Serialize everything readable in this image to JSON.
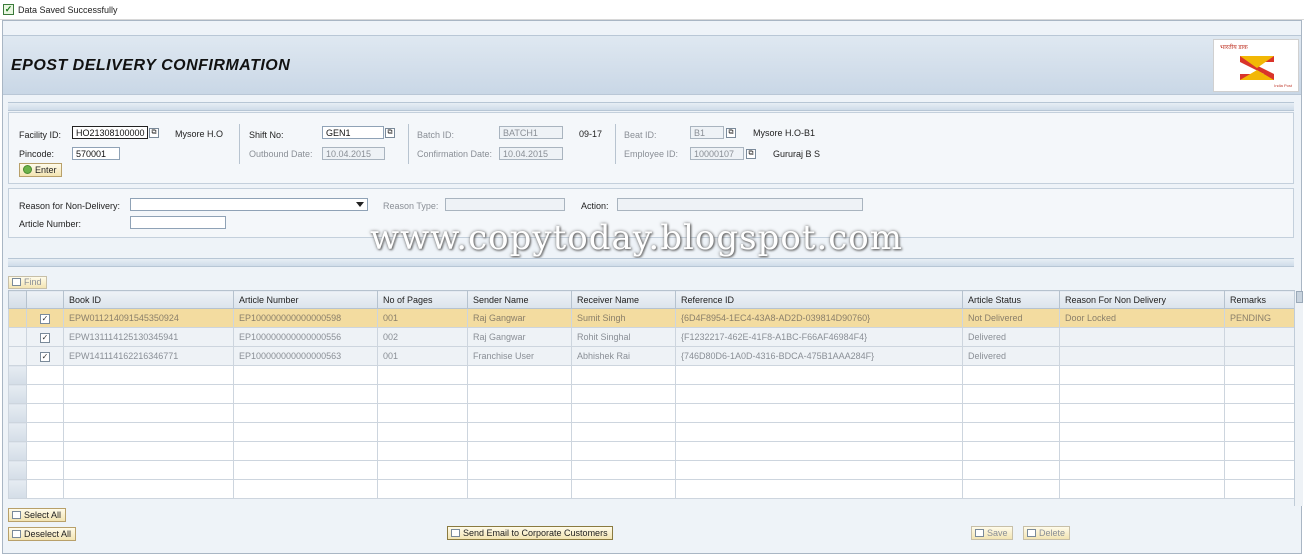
{
  "status": {
    "message": "Data Saved Successfully"
  },
  "header": {
    "title": "EPOST DELIVERY CONFIRMATION",
    "logo_text": "भारतीय डाक",
    "logo_subtext": "India Post"
  },
  "form": {
    "facility_id_label": "Facility ID:",
    "facility_id_value": "HO21308100000",
    "facility_name": "Mysore H.O",
    "pincode_label": "Pincode:",
    "pincode_value": "570001",
    "shift_no_label": "Shift No:",
    "shift_no_value": "GEN1",
    "outbound_date_label": "Outbound Date:",
    "outbound_date_value": "10.04.2015",
    "batch_id_label": "Batch ID:",
    "batch_id_value": "BATCH1",
    "batch_time": "09-17",
    "confirmation_date_label": "Confirmation Date:",
    "confirmation_date_value": "10.04.2015",
    "beat_id_label": "Beat ID:",
    "beat_id_value": "B1",
    "beat_name": "Mysore H.O-B1",
    "employee_id_label": "Employee ID:",
    "employee_id_value": "10000107",
    "employee_name": "Gururaj B S",
    "enter_button": "Enter"
  },
  "reason": {
    "reason_label": "Reason for Non-Delivery:",
    "reason_value": "",
    "reason_type_label": "Reason Type:",
    "reason_type_value": "",
    "action_label": "Action:",
    "action_value": "",
    "article_number_label": "Article Number:",
    "article_number_value": ""
  },
  "watermark": "www.copytoday.blogspot.com",
  "toolbar": {
    "find_button": "Find"
  },
  "table": {
    "columns": [
      "Book ID",
      "Article Number",
      "No of Pages",
      "Sender Name",
      "Receiver Name",
      "Reference ID",
      "Article Status",
      "Reason For Non Delivery",
      "Remarks"
    ],
    "rows": [
      {
        "checked": true,
        "selected": true,
        "cells": [
          "EPW011214091545350924",
          "EP100000000000000598",
          "001",
          "Raj Gangwar",
          "Sumit Singh",
          "{6D4F8954-1EC4-43A8-AD2D-039814D90760}",
          "Not Delivered",
          "Door Locked",
          "PENDING"
        ]
      },
      {
        "checked": true,
        "selected": false,
        "cells": [
          "EPW131114125130345941",
          "EP100000000000000556",
          "002",
          "Raj Gangwar",
          "Rohit Singhal",
          "{F1232217-462E-41F8-A1BC-F66AF46984F4}",
          "Delivered",
          "",
          ""
        ]
      },
      {
        "checked": true,
        "selected": false,
        "cells": [
          "EPW141114162216346771",
          "EP100000000000000563",
          "001",
          "Franchise User",
          "Abhishek Rai",
          "{746D80D6-1A0D-4316-BDCA-475B1AAA284F}",
          "Delivered",
          "",
          ""
        ]
      }
    ],
    "empty_rows": 7
  },
  "footer": {
    "select_all": "Select All",
    "deselect_all": "Deselect All",
    "send_email": "Send Email to Corporate Customers",
    "save": "Save",
    "delete": "Delete"
  }
}
